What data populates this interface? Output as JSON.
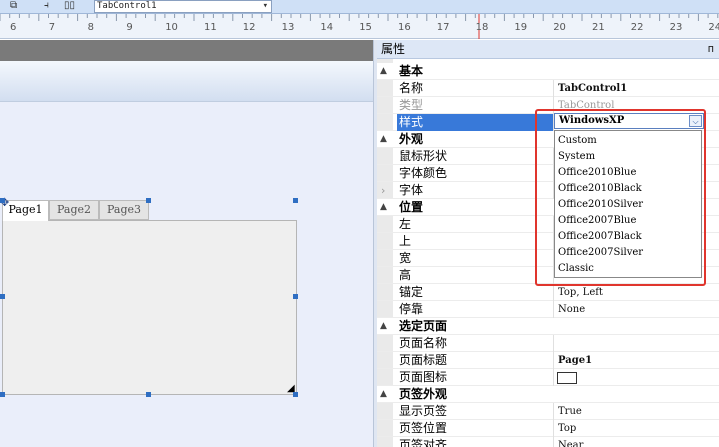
{
  "toolbar": {
    "combo_value": "TabControl1",
    "combo_arrow": "▾"
  },
  "ruler": {
    "ticks": [
      "6",
      "7",
      "8",
      "9",
      "10",
      "11",
      "12",
      "13",
      "14",
      "15",
      "16",
      "17",
      "18",
      "19",
      "20",
      "21",
      "22",
      "23",
      "24"
    ]
  },
  "designer": {
    "tabs": [
      "Page1",
      "Page2",
      "Page3"
    ],
    "move_glyph": "✥",
    "resize_glyph": "◢"
  },
  "properties": {
    "title": "属性",
    "pin_glyph": "ᴨ",
    "rows": {
      "cat_basic": "基本",
      "name_label": "名称",
      "name_value": "TabControl1",
      "type_label": "类型",
      "type_value": "TabControl",
      "style_label": "样式",
      "cat_appearance": "外观",
      "cursor_label": "鼠标形状",
      "fontcolor_label": "字体颜色",
      "font_label": "字体",
      "cat_position": "位置",
      "left_label": "左",
      "top_label": "上",
      "width_label": "宽",
      "height_label": "高",
      "anchor_label": "锚定",
      "anchor_value": "Top, Left",
      "dock_label": "停靠",
      "dock_value": "None",
      "cat_selpage": "选定页面",
      "pagename_label": "页面名称",
      "pagetitle_label": "页面标题",
      "pagetitle_value": "Page1",
      "pageicon_label": "页面图标",
      "cat_tabappear": "页签外观",
      "showtab_label": "显示页签",
      "showtab_value": "True",
      "tabpos_label": "页签位置",
      "tabpos_value": "Top",
      "tabalign_label": "页签对齐",
      "tabalign_value": "Near"
    },
    "collapse_glyph": "▲",
    "expand_glyph": "›"
  },
  "style_dropdown": {
    "current": "WindowsXP",
    "arrow": "⌵",
    "options": [
      "Custom",
      "System",
      "Office2010Blue",
      "Office2010Black",
      "Office2010Silver",
      "Office2007Blue",
      "Office2007Black",
      "Office2007Silver",
      "Classic"
    ]
  },
  "colors": {
    "selection": "#3879d9",
    "highlight_box": "#e0352d",
    "toolbar_bg": "#cfe0f6"
  }
}
